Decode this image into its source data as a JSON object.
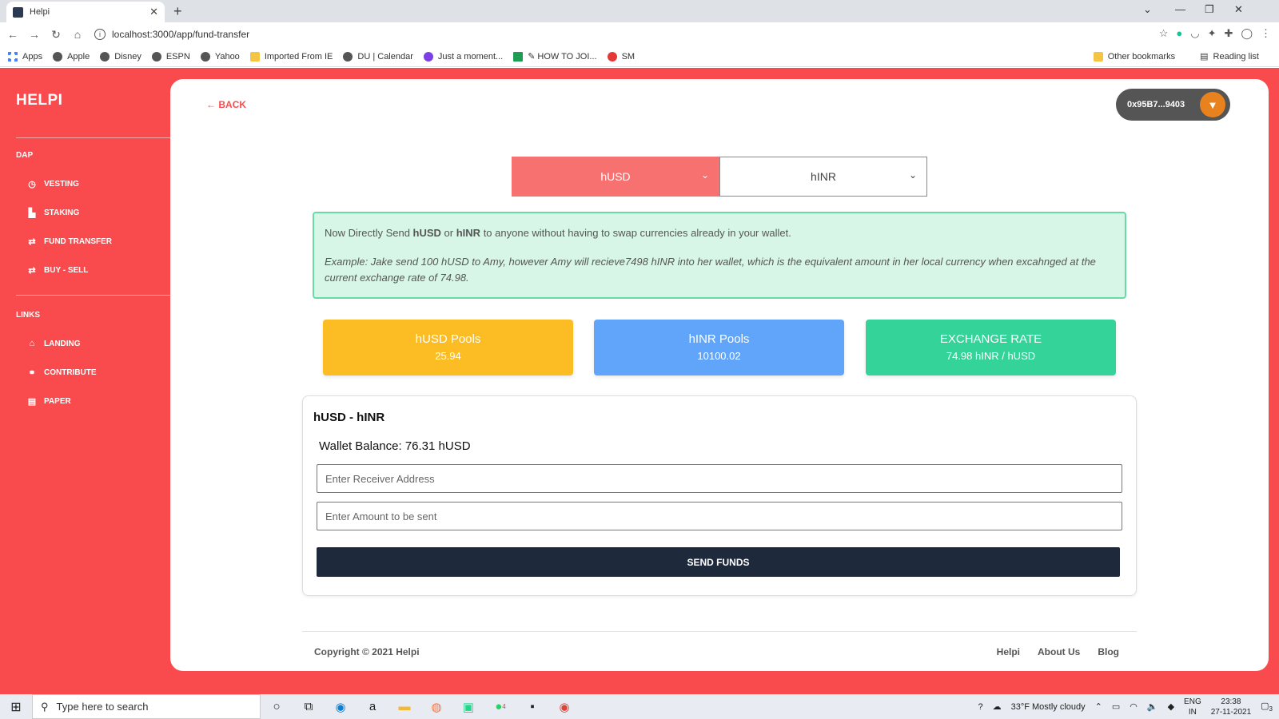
{
  "browser": {
    "tab_title": "Helpi",
    "url": "localhost:3000/app/fund-transfer",
    "bookmarks": [
      "Apps",
      "Apple",
      "Disney",
      "ESPN",
      "Yahoo",
      "Imported From IE",
      "DU | Calendar",
      "Just a moment...",
      "HOW TO JOI...",
      "SM"
    ],
    "other_bookmarks": "Other bookmarks",
    "reading_list": "Reading list"
  },
  "sidebar": {
    "brand": "HELPI",
    "dap_heading": "DAP",
    "dap_items": [
      {
        "label": "VESTING",
        "icon": "clock-icon"
      },
      {
        "label": "STAKING",
        "icon": "staking-icon"
      },
      {
        "label": "FUND TRANSFER",
        "icon": "transfer-icon"
      },
      {
        "label": "BUY - SELL",
        "icon": "transfer-icon"
      }
    ],
    "links_heading": "LINKS",
    "link_items": [
      {
        "label": "LANDING",
        "icon": "home-icon"
      },
      {
        "label": "CONTRIBUTE",
        "icon": "handshake-icon"
      },
      {
        "label": "PAPER",
        "icon": "document-icon"
      }
    ]
  },
  "header": {
    "back_label": "BACK",
    "wallet_address": "0x95B7...9403"
  },
  "currency": {
    "from": "hUSD",
    "to": "hINR"
  },
  "notice": {
    "line1_prefix": "Now Directly Send ",
    "line1_cur1": "hUSD",
    "line1_or": " or ",
    "line1_cur2": "hINR",
    "line1_suffix": " to anyone without having to swap currencies already in your wallet.",
    "example": "Example: Jake send 100 hUSD to Amy, however Amy will recieve7498 hINR into her wallet, which is the equivalent amount in her local currency when excahnged at the current exchange rate of 74.98."
  },
  "stats": [
    {
      "title": "hUSD Pools",
      "value": "25.94"
    },
    {
      "title": "hINR Pools",
      "value": "10100.02"
    },
    {
      "title": "EXCHANGE RATE",
      "value": "74.98 hINR / hUSD"
    }
  ],
  "form": {
    "title": "hUSD - hINR",
    "balance": "Wallet Balance: 76.31 hUSD",
    "receiver_placeholder": "Enter Receiver Address",
    "amount_placeholder": "Enter Amount to be sent",
    "send_label": "SEND FUNDS"
  },
  "footer": {
    "copyright": "Copyright © 2021 Helpi",
    "links": [
      "Helpi",
      "About Us",
      "Blog"
    ]
  },
  "taskbar": {
    "search_placeholder": "Type here to search",
    "weather": "33°F  Mostly cloudy",
    "lang": "ENG",
    "region": "IN",
    "time": "23:38",
    "date": "27-11-2021",
    "notification_count": "3",
    "whatsapp_badge": "4"
  }
}
